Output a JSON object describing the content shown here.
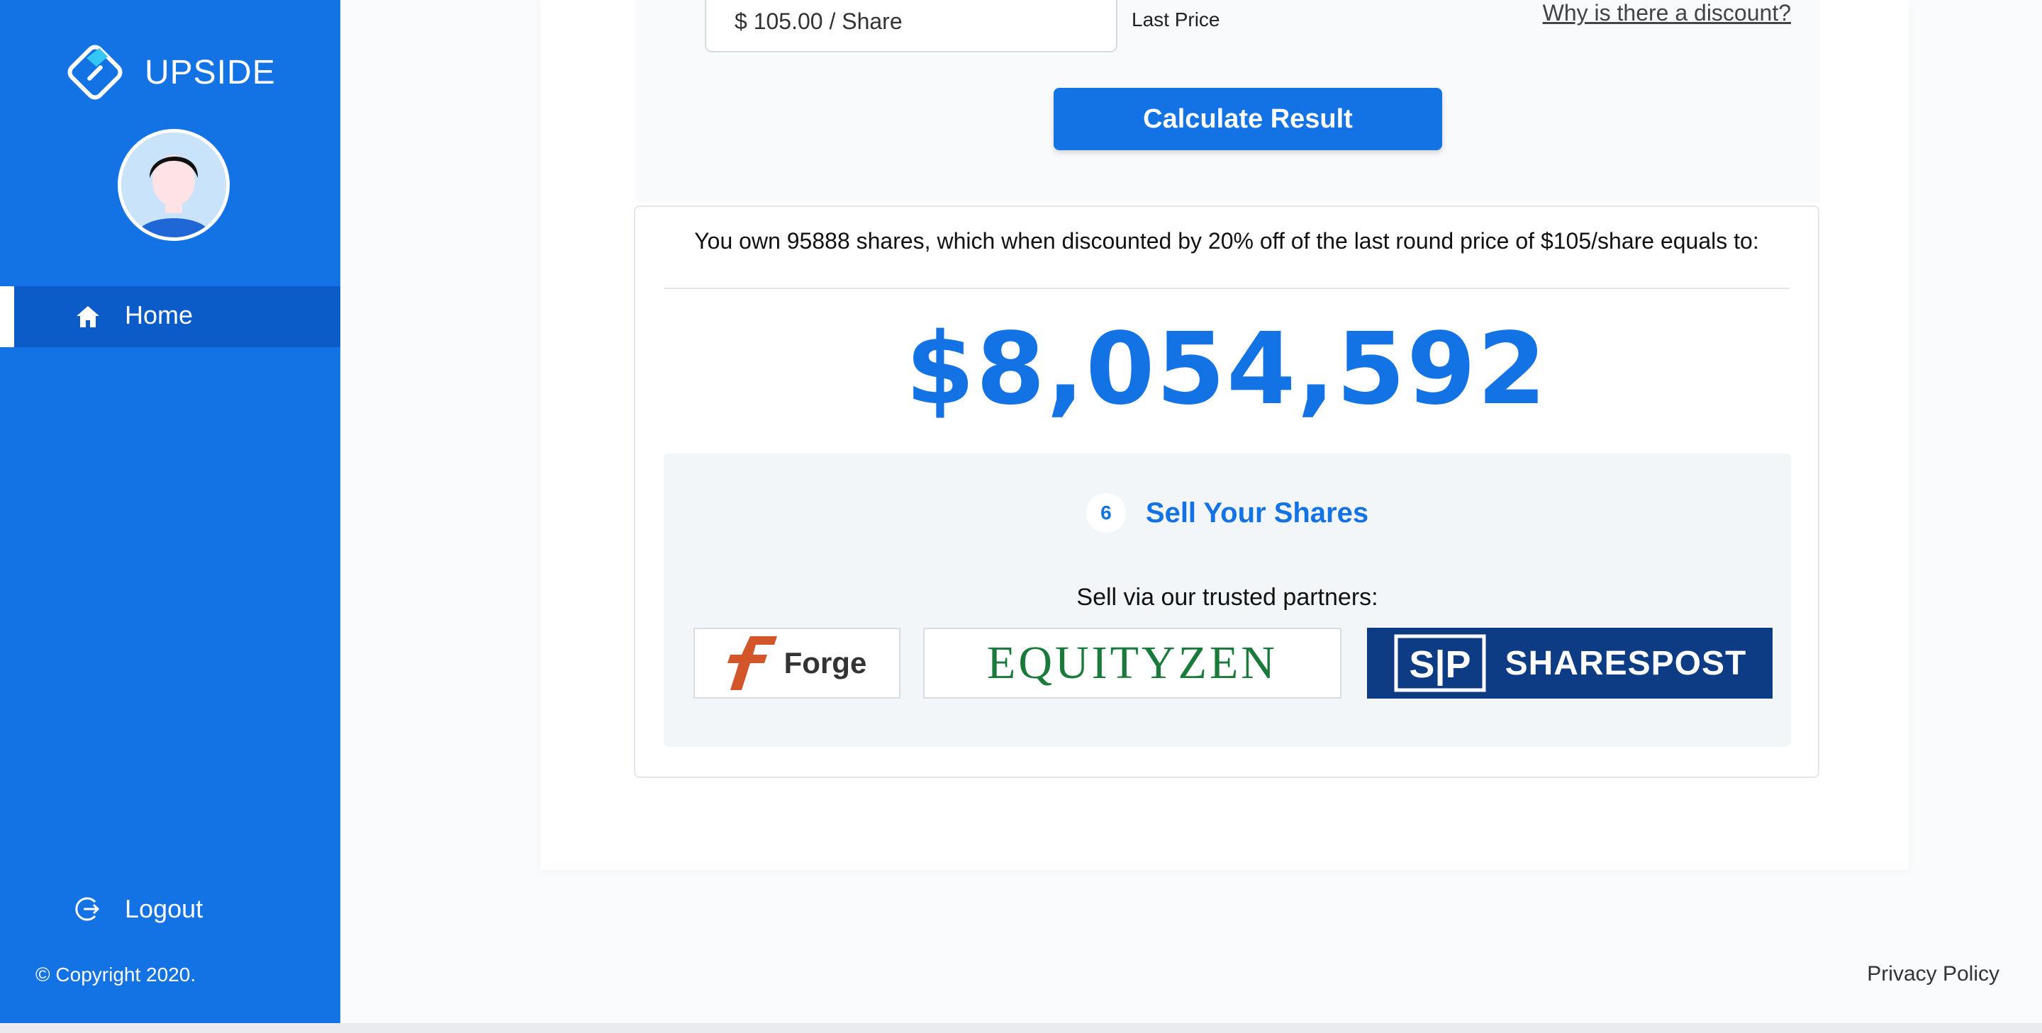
{
  "brand": {
    "name": "UPSIDE"
  },
  "nav": {
    "home_label": "Home",
    "logout_label": "Logout"
  },
  "footer": {
    "copyright": "© Copyright 2020.",
    "privacy": "Privacy Policy"
  },
  "form": {
    "price_value": "$ 105.00 / Share",
    "price_label": "Last Price",
    "discount_link": "Why is there a discount?",
    "calculate_button": "Calculate Result"
  },
  "result": {
    "summary": "You own 95888 shares, which when discounted by 20% off of the last round price of $105/share equals to:",
    "amount": "$8,054,592"
  },
  "sell": {
    "step_number": "6",
    "title": "Sell Your Shares",
    "subtitle": "Sell via our trusted partners:",
    "partners": [
      {
        "name": "Forge"
      },
      {
        "name": "EQUITYZEN"
      },
      {
        "name": "SHARESPOST"
      }
    ]
  },
  "colors": {
    "accent": "#1372e4",
    "active_nav": "#0b5cc8",
    "sharespost_bg": "#0d3c85"
  }
}
